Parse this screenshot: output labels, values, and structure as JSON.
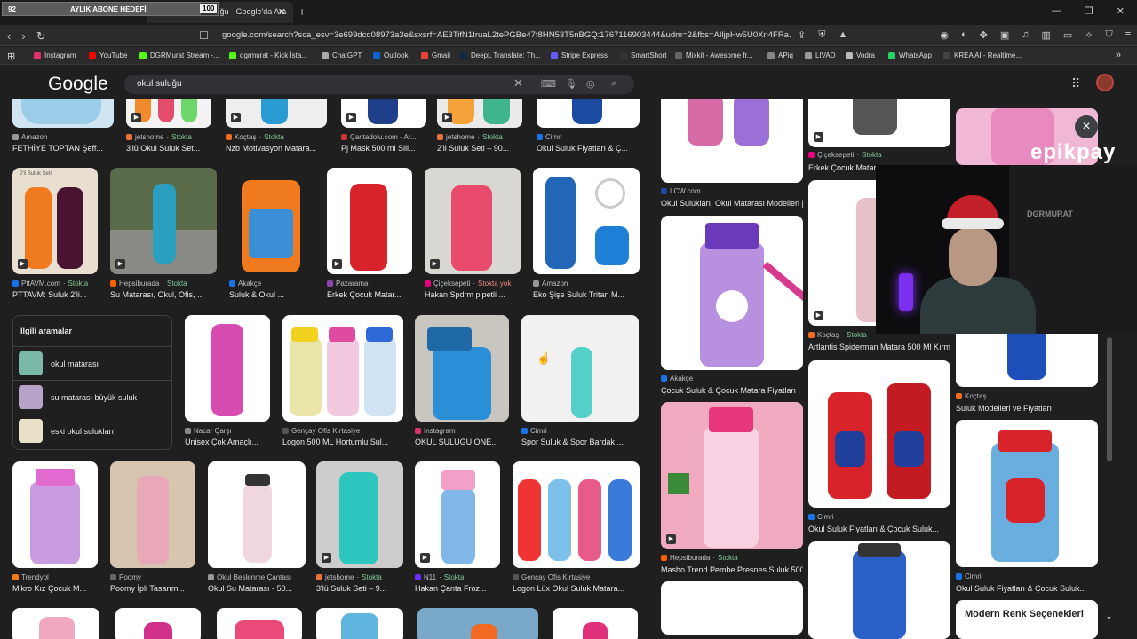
{
  "overlay": {
    "goal_left": "92",
    "goal_title": "AYLIK ABONE HEDEFİ",
    "goal_right": "100",
    "goal_progress": 0.92
  },
  "browser": {
    "tab_title": "okul suluğu - Google'da Ara",
    "url": "google.com/search?sca_esv=3e699dcd08973a3e&sxsrf=AE3TifN1IruaL2tePGBe47t8HN53T5nBGQ:1767116903444&udm=2&fbs=AIljpHw5U0Xn4FRa...",
    "bookmarks": [
      "Instagram",
      "YouTube",
      "DGRMurat Stream -...",
      "dgrmurat - Kick İsta...",
      "ChatGPT",
      "Outlook",
      "Gmail",
      "DeepL Translate: Th...",
      "Stripe Express",
      "SmartShort",
      "Mixkit - Awesome fr...",
      "APiq",
      "LIVAD",
      "Vodra",
      "WhatsApp",
      "KREA AI - Realtime..."
    ]
  },
  "google": {
    "logo": "Google",
    "query": "okul suluğu"
  },
  "results": {
    "row1": [
      {
        "source": "Amazon",
        "stock": "",
        "title": "FETHİYE TOPTAN Şeff..."
      },
      {
        "source": "jetshome",
        "stock": "Stokta",
        "title": "3'lü Okul Suluk Set..."
      },
      {
        "source": "Koçtaş",
        "stock": "Stokta",
        "title": "Nzb Motivasyon Matara..."
      },
      {
        "source": "Çantadolu.com - Ar...",
        "stock": "",
        "title": "Pj Mask 500 ml Sili..."
      },
      {
        "source": "jetshome",
        "stock": "Stokta",
        "title": "2'li Suluk Seti – 90..."
      },
      {
        "source": "Cimri",
        "stock": "",
        "title": "Okul Suluk Fiyatları & Ç..."
      }
    ],
    "row2": [
      {
        "source": "PttAVM.com",
        "stock": "Stokta",
        "title": "PTTAVM: Suluk 2'li..."
      },
      {
        "source": "Hepsiburada",
        "stock": "Stokta",
        "title": "Su Matarası, Okul, Ofis, ..."
      },
      {
        "source": "Akakçe",
        "stock": "",
        "title": "Suluk & Okul ..."
      },
      {
        "source": "Pazarama",
        "stock": "",
        "title": "Erkek Çocuk Matar..."
      },
      {
        "source": "Çiçeksepeti",
        "stock": "Stokta yok",
        "title": "Hakan Spdrm pipetli ..."
      },
      {
        "source": "Amazon",
        "stock": "",
        "title": "Eko Şişe Suluk Tritan M..."
      }
    ],
    "row3": [
      {
        "source": "Nacar Çarşı",
        "stock": "",
        "title": "Unisex Çok Amaçlı..."
      },
      {
        "source": "Gençay Ofis Kırtasiye",
        "stock": "",
        "title": "Logon 500 ML Hortumlu Sul..."
      },
      {
        "source": "Instagram",
        "stock": "",
        "title": "OKUL SULUĞU ÖNE..."
      },
      {
        "source": "Cimri",
        "stock": "",
        "title": "Spor Suluk & Spor Bardak ..."
      }
    ],
    "row4": [
      {
        "source": "Trendyol",
        "stock": "",
        "title": "Mikro Kız Çocuk M..."
      },
      {
        "source": "Poomy",
        "stock": "",
        "title": "Poomy İpli Tasarım..."
      },
      {
        "source": "Okul Beslenme Çantası",
        "stock": "",
        "title": "Okul Su Matarası - 50..."
      },
      {
        "source": "jetshome",
        "stock": "Stokta",
        "title": "3'lü Suluk Seti – 9..."
      },
      {
        "source": "N11",
        "stock": "Stokta",
        "title": "Hakan Çanta Froz..."
      },
      {
        "source": "Gençay Ofis Kırtasiye",
        "stock": "",
        "title": "Logon Lüx Okul Suluk Matara..."
      }
    ],
    "thumb_label_1": "2'li Suluk Seti"
  },
  "related": {
    "heading": "İlgili aramalar",
    "items": [
      {
        "bold": "okul",
        "rest": " matarası",
        "html_bold_rest": true
      },
      {
        "bold": "",
        "rest": "su matarası büyük suluk"
      },
      {
        "bold": "eski",
        "rest": " okul sulukları"
      }
    ],
    "item_labels": [
      "okul matarası",
      "su matarası büyük suluk",
      "eski okul sulukları"
    ]
  },
  "panel": {
    "col1": [
      {
        "source": "LCW.com",
        "stock": "",
        "title": "Okul Sulukları, Okul Matarası Modelleri | ..."
      },
      {
        "source": "Akakçe",
        "stock": "",
        "title": "Çocuk Suluk & Çocuk Matara Fiyatları | ..."
      },
      {
        "source": "Hepsiburada",
        "stock": "Stokta",
        "title": "Masho Trend Pembe Presnes Suluk 500 ..."
      }
    ],
    "col2": [
      {
        "source": "Çiçeksepeti",
        "stock": "Stokta",
        "title": "Erkek Çocuk Matara"
      },
      {
        "source": "Koçtaş",
        "stock": "Stokta",
        "title": "Artlantis Spiderman Matara 500 Ml Kırmı..."
      },
      {
        "source": "Cimri",
        "stock": "",
        "title": "Okul Suluk Fiyatları & Çocuk Suluk..."
      }
    ],
    "col3": [
      {
        "source": "Koçtaş",
        "stock": "",
        "title": "Suluk Modelleri ve Fiyatları"
      },
      {
        "source": "Cimri",
        "stock": "",
        "title": "Okul Suluk Fiyatları & Çocuk Suluk..."
      }
    ],
    "bottom_text": "Modern Renk Seçenekleri",
    "close": "×"
  },
  "stream": {
    "brand": "epikpay",
    "cam_label": "DGRMURAT"
  },
  "colors": {
    "bg": "#1f1f1f",
    "stock_green": "#81c995",
    "out_red": "#f28b82",
    "text_secondary": "#bdc1c6"
  }
}
